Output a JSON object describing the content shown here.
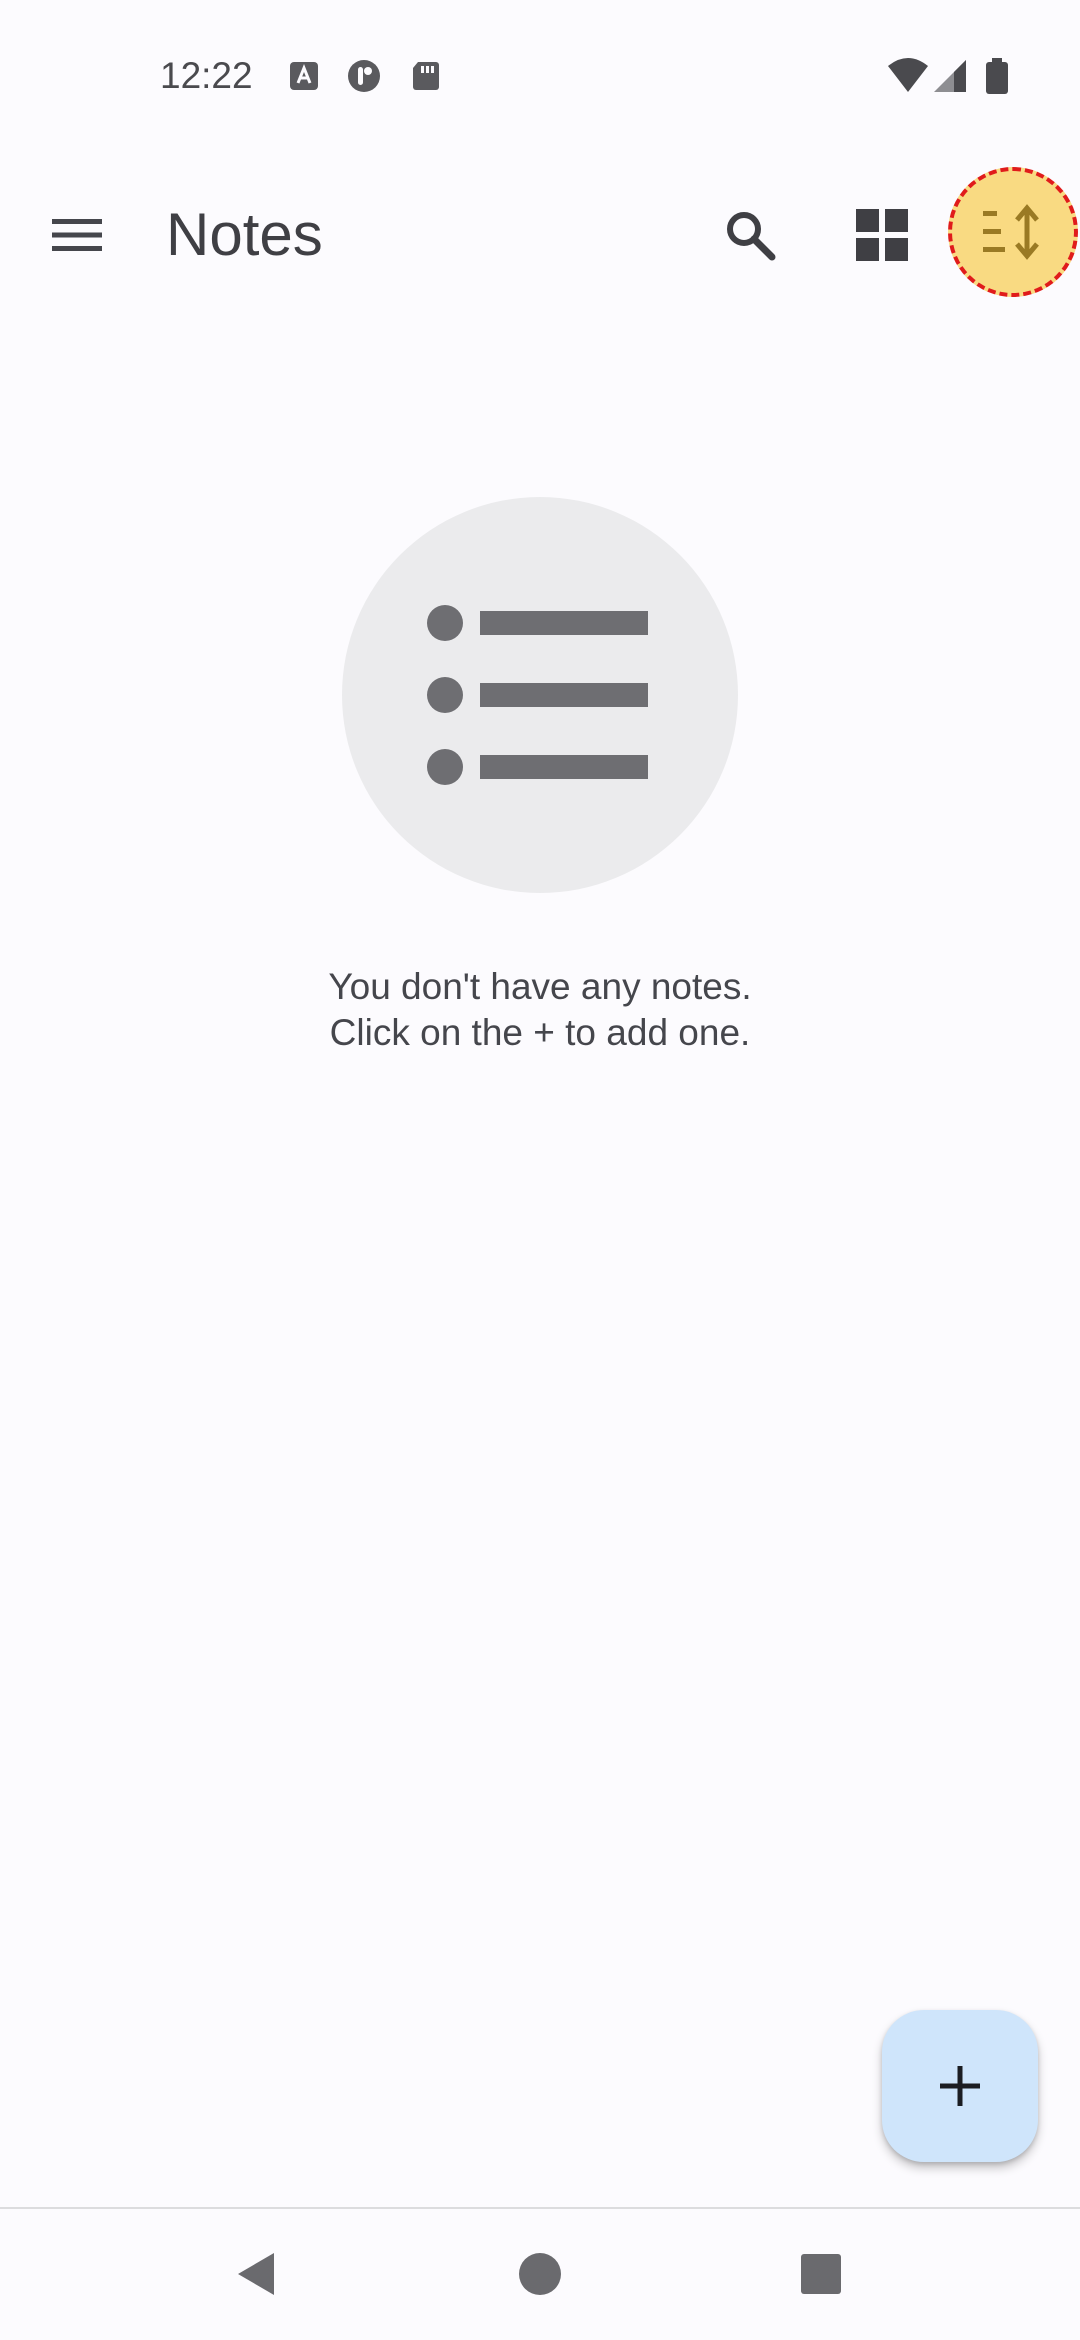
{
  "status_bar": {
    "time": "12:22",
    "notification_icons": [
      "text-a-icon",
      "app-notification-icon",
      "sd-card-icon"
    ],
    "system_icons": [
      "wifi-icon",
      "cellular-signal-icon",
      "battery-icon"
    ]
  },
  "app_bar": {
    "title": "Notes",
    "actions": [
      "search-icon",
      "grid-layout-icon",
      "sort-icon"
    ]
  },
  "empty_state": {
    "illustration": "list-icon",
    "line1": "You don't have any notes.",
    "line2": "Click on the + to add one."
  },
  "fab": {
    "icon": "add-icon"
  },
  "nav_bar": {
    "buttons": [
      "back-icon",
      "home-icon",
      "recents-icon"
    ]
  },
  "colors": {
    "background": "#fcfbfe",
    "fab": "#cfe5fb",
    "sort_highlight": "#f9da82",
    "sort_icon": "#9a7a24",
    "highlight_border": "#e01b1b",
    "illustration_bg": "#ebebed",
    "illustration_fg": "#6e6e72"
  }
}
